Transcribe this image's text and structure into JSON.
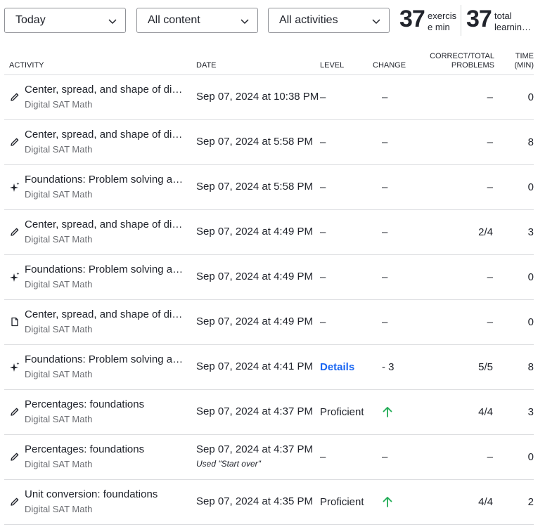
{
  "filters": {
    "date_range": "Today",
    "content": "All content",
    "activity_type": "All activities"
  },
  "stats": {
    "exercise_minutes": "37",
    "exercise_label": "exercise min",
    "total_minutes": "37",
    "total_label": "total learning minutes"
  },
  "columns": {
    "activity": "Activity",
    "date": "Date",
    "level": "Level",
    "change": "Change",
    "correct_total": "Correct/Total Problems",
    "time": "Time (min)"
  },
  "rows": [
    {
      "icon": "pencil-icon",
      "title": "Center, spread, and shape of distributions: foundations",
      "course": "Digital SAT Math",
      "date": "Sep 07, 2024 at 10:38 PM",
      "note": "",
      "level": "–",
      "change": "–",
      "change_type": "dash",
      "correct": "–",
      "time": "0"
    },
    {
      "icon": "pencil-icon",
      "title": "Center, spread, and shape of distributions: foundations",
      "course": "Digital SAT Math",
      "date": "Sep 07, 2024 at 5:58 PM",
      "note": "",
      "level": "–",
      "change": "–",
      "change_type": "dash",
      "correct": "–",
      "time": "8"
    },
    {
      "icon": "sparkle-icon",
      "title": "Foundations: Problem solving and data analysis",
      "course": "Digital SAT Math",
      "date": "Sep 07, 2024 at 5:58 PM",
      "note": "",
      "level": "–",
      "change": "–",
      "change_type": "dash",
      "correct": "–",
      "time": "0"
    },
    {
      "icon": "pencil-icon",
      "title": "Center, spread, and shape of distributions: foundations",
      "course": "Digital SAT Math",
      "date": "Sep 07, 2024 at 4:49 PM",
      "note": "",
      "level": "–",
      "change": "–",
      "change_type": "dash",
      "correct": "2/4",
      "time": "3"
    },
    {
      "icon": "sparkle-icon",
      "title": "Foundations: Problem solving and data analysis",
      "course": "Digital SAT Math",
      "date": "Sep 07, 2024 at 4:49 PM",
      "note": "",
      "level": "–",
      "change": "–",
      "change_type": "dash",
      "correct": "–",
      "time": "0"
    },
    {
      "icon": "document-icon",
      "title": "Center, spread, and shape of distributions: foundations",
      "course": "Digital SAT Math",
      "date": "Sep 07, 2024 at 4:49 PM",
      "note": "",
      "level": "–",
      "change": "–",
      "change_type": "dash",
      "correct": "–",
      "time": "0"
    },
    {
      "icon": "sparkle-icon",
      "title": "Foundations: Problem solving and data analysis",
      "course": "Digital SAT Math",
      "date": "Sep 07, 2024 at 4:41 PM",
      "note": "",
      "level": "Details",
      "change": "- 3",
      "change_type": "text",
      "correct": "5/5",
      "time": "8"
    },
    {
      "icon": "pencil-icon",
      "title": "Percentages: foundations",
      "course": "Digital SAT Math",
      "date": "Sep 07, 2024 at 4:37 PM",
      "note": "",
      "level": "Proficient",
      "change": "up",
      "change_type": "arrow",
      "correct": "4/4",
      "time": "3"
    },
    {
      "icon": "pencil-icon",
      "title": "Percentages: foundations",
      "course": "Digital SAT Math",
      "date": "Sep 07, 2024 at 4:37 PM",
      "note": "Used \"Start over\"",
      "level": "–",
      "change": "–",
      "change_type": "dash",
      "correct": "–",
      "time": "0"
    },
    {
      "icon": "pencil-icon",
      "title": "Unit conversion: foundations",
      "course": "Digital SAT Math",
      "date": "Sep 07, 2024 at 4:35 PM",
      "note": "",
      "level": "Proficient",
      "change": "up",
      "change_type": "arrow",
      "correct": "4/4",
      "time": "2"
    }
  ],
  "colors": {
    "link": "#1865f2",
    "success": "#1fab54",
    "muted": "#6b6d72",
    "border": "#dcdde0"
  }
}
